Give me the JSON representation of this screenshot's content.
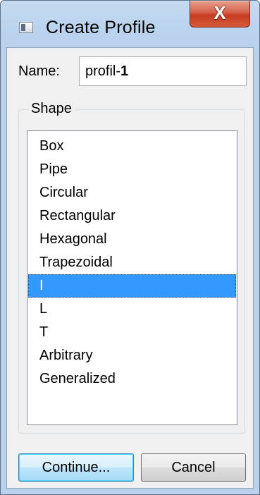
{
  "window": {
    "title": "Create Profile",
    "close_glyph": "X",
    "icon": "window-app-icon"
  },
  "form": {
    "name_label": "Name:",
    "name_value_prefix": "profil-",
    "name_value_suffix": "1"
  },
  "shape_group": {
    "legend": "Shape",
    "items": [
      "Box",
      "Pipe",
      "Circular",
      "Rectangular",
      "Hexagonal",
      "Trapezoidal",
      "I",
      "L",
      "T",
      "Arbitrary",
      "Generalized"
    ],
    "selected": "I"
  },
  "buttons": {
    "continue_label": "Continue...",
    "cancel_label": "Cancel"
  },
  "colors": {
    "selection": "#3399ff",
    "close_button": "#c73c22",
    "title_bar": "#b9d1ea"
  }
}
